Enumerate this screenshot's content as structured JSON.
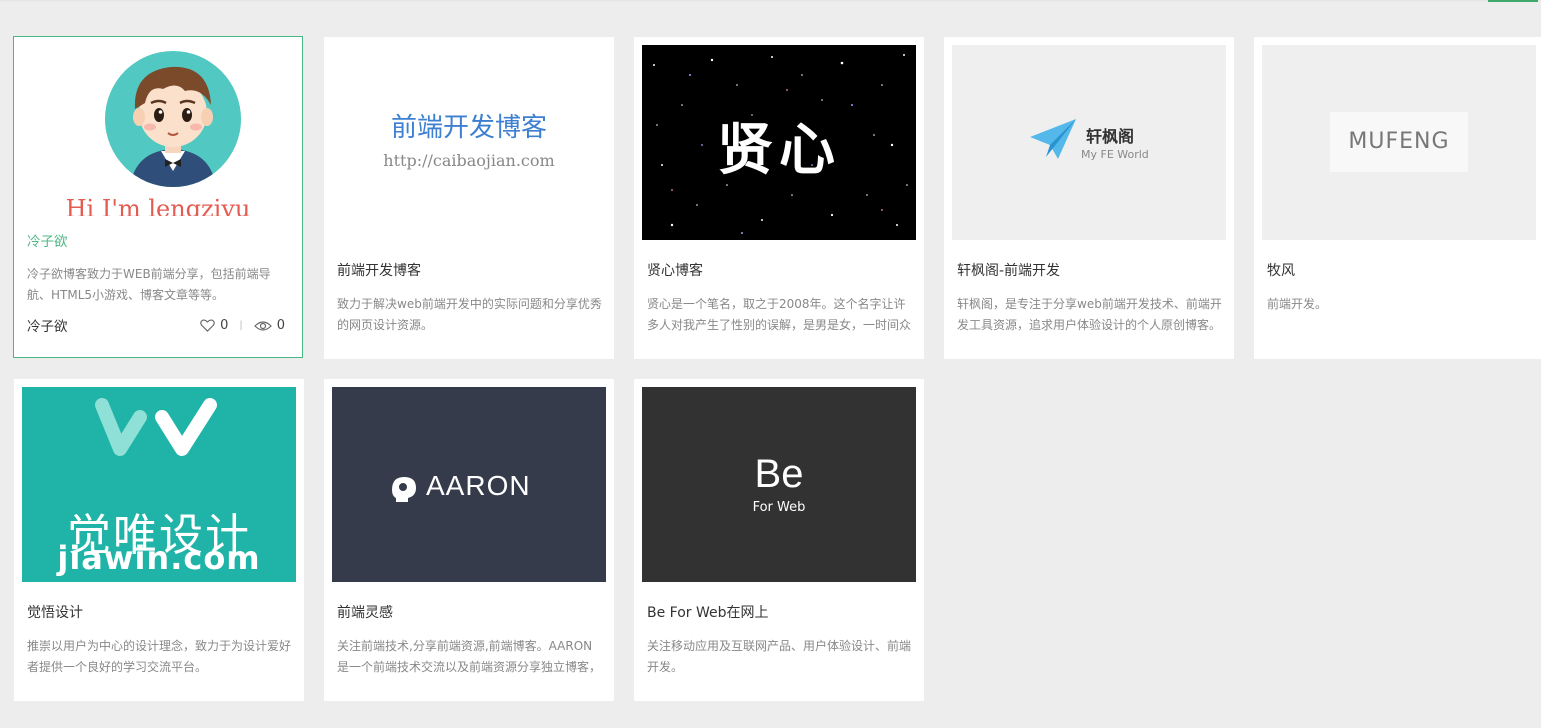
{
  "cards": [
    {
      "title": "冷子欲",
      "desc": "冷子欲博客致力于WEB前端分享，包括前端导航、HTML5小游戏、博客文章等等。",
      "author": "冷子欲",
      "likes": "0",
      "views": "0",
      "thumb": {
        "caption": "Hi I'm lengziyu"
      }
    },
    {
      "title": "前端开发博客",
      "desc": "致力于解决web前端开发中的实际问题和分享优秀的网页设计资源。",
      "thumb": {
        "title": "前端开发博客",
        "url": "http://caibaojian.com"
      }
    },
    {
      "title": "贤心博客",
      "desc": "贤心是一个笔名，取之于2008年。这个名字让许多人对我产生了性别的误解，是男是女，一时间众",
      "thumb": {
        "text": "贤心"
      }
    },
    {
      "title": "轩枫阁-前端开发",
      "desc": "轩枫阁，是专注于分享web前端开发技术、前端开发工具资源，追求用户体验设计的个人原创博客。",
      "thumb": {
        "name": "轩枫阁",
        "sub": "My FE World"
      }
    },
    {
      "title": "牧风",
      "desc": "前端开发。",
      "thumb": {
        "text": "MUFENG"
      }
    },
    {
      "title": "觉悟设计",
      "desc": "推崇以用户为中心的设计理念，致力于为设计爱好者提供一个良好的学习交流平台。",
      "thumb": {
        "cn": "觉唯设计",
        "en": "jiawin.com"
      }
    },
    {
      "title": "前端灵感",
      "desc": "关注前端技术,分享前端资源,前端博客。AARON是一个前端技术交流以及前端资源分享独立博客，",
      "thumb": {
        "text": "AARON"
      }
    },
    {
      "title": "Be For Web在网上",
      "desc": "关注移动应用及互联网产品、用户体验设计、前端开发。",
      "thumb": {
        "big": "Be",
        "small": "For Web"
      }
    }
  ],
  "colors": {
    "accent": "#48b884",
    "background": "#ededed"
  },
  "icons": {
    "like": "heart-icon",
    "views": "eye-icon"
  }
}
